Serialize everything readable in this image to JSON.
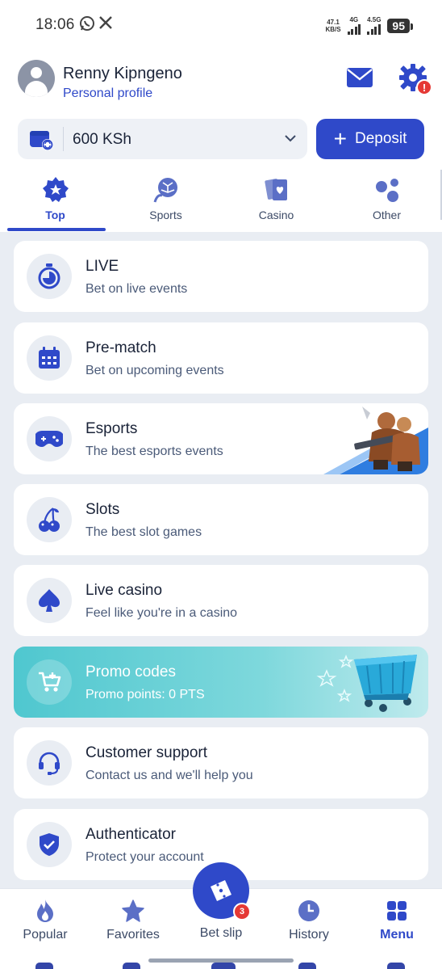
{
  "status_bar": {
    "time": "18:06",
    "net_speed": "47.1",
    "net_unit": "KB/S",
    "net1": "4G",
    "net2": "4.5G",
    "battery": "95"
  },
  "header": {
    "user_name": "Renny Kipngeno",
    "profile_link": "Personal profile",
    "settings_alert": "!"
  },
  "balance": {
    "amount": "600 KSh",
    "deposit_label": "Deposit"
  },
  "tabs": [
    {
      "label": "Top",
      "icon": "badge-icon",
      "active": true
    },
    {
      "label": "Sports",
      "icon": "sports-ball-icon",
      "active": false
    },
    {
      "label": "Casino",
      "icon": "cards-icon",
      "active": false
    },
    {
      "label": "Other",
      "icon": "dots-icon",
      "active": false
    }
  ],
  "menu_items": [
    {
      "title": "LIVE",
      "subtitle": "Bet on live events",
      "icon": "stopwatch-icon"
    },
    {
      "title": "Pre-match",
      "subtitle": "Bet on upcoming events",
      "icon": "calendar-icon"
    },
    {
      "title": "Esports",
      "subtitle": "The best esports events",
      "icon": "gamepad-icon"
    },
    {
      "title": "Slots",
      "subtitle": "The best slot games",
      "icon": "cherries-icon"
    },
    {
      "title": "Live casino",
      "subtitle": "Feel like you're in a casino",
      "icon": "spade-icon"
    },
    {
      "title": "Promo codes",
      "subtitle": "Promo points: 0 PTS",
      "icon": "cart-icon"
    },
    {
      "title": "Customer support",
      "subtitle": "Contact us and we'll help you",
      "icon": "headset-icon"
    },
    {
      "title": "Authenticator",
      "subtitle": "Protect your account",
      "icon": "shield-check-icon"
    }
  ],
  "bottom_nav": [
    {
      "label": "Popular",
      "icon": "flame-icon",
      "active": false
    },
    {
      "label": "Favorites",
      "icon": "star-icon",
      "active": false
    },
    {
      "label": "Bet slip",
      "icon": "ticket-icon",
      "badge": "3",
      "active": false
    },
    {
      "label": "History",
      "icon": "clock-icon",
      "active": false
    },
    {
      "label": "Menu",
      "icon": "grid-icon",
      "active": true
    }
  ],
  "colors": {
    "primary": "#2f49c9",
    "background": "#e9edf3",
    "alert": "#e53935",
    "promo": "#4fc7cf"
  }
}
